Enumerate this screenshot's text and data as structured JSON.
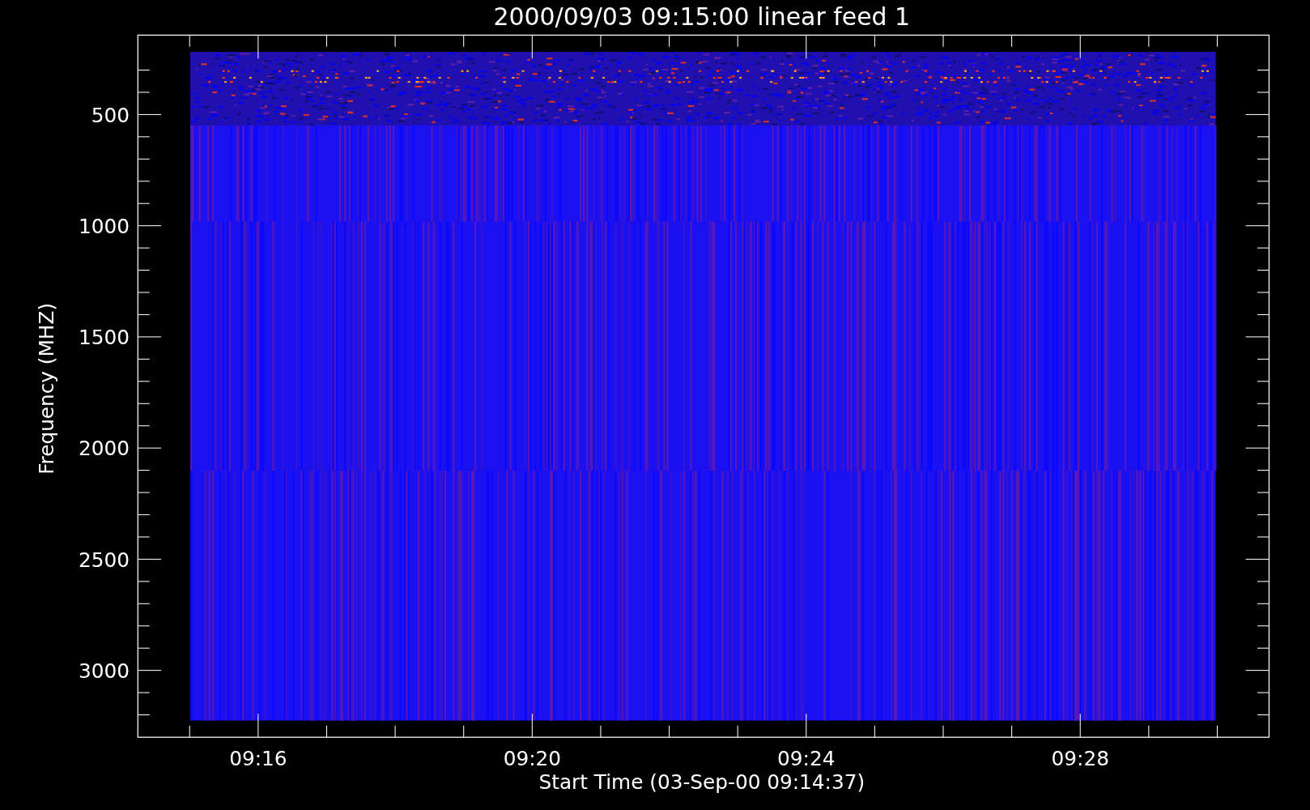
{
  "plot": {
    "title": "2000/09/03 09:15:00 linear feed 1",
    "xlabel": "Start Time (03-Sep-00 09:14:37)",
    "ylabel": "Frequency (MHZ)",
    "x_tick_labels": [
      "09:16",
      "09:20",
      "09:24",
      "09:28"
    ],
    "y_tick_labels": [
      "500",
      "1000",
      "1500",
      "2000",
      "2500",
      "3000"
    ]
  }
}
